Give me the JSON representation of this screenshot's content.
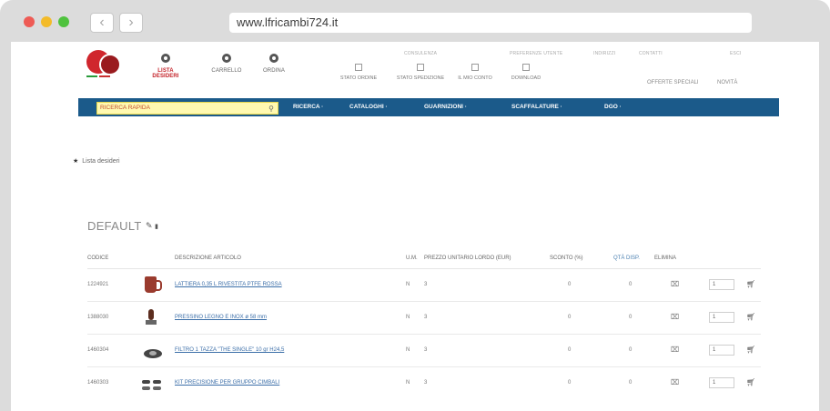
{
  "browser": {
    "url": "www.lfricambi724.it",
    "back": "‹",
    "forward": "›"
  },
  "header": {
    "user_links": [
      {
        "label": "LISTA DESIDERI",
        "icon": "heart-icon",
        "active": true
      },
      {
        "label": "CARRELLO",
        "icon": "cart-icon",
        "active": false
      },
      {
        "label": "ORDINA",
        "icon": "order-icon",
        "active": false
      }
    ],
    "top_mini_links": [
      "CONSULENZA",
      "PREFERENZE UTENTE",
      "INDIRIZZI",
      "CONTATTI",
      "ESCI"
    ],
    "status_links": [
      {
        "label": "STATO ORDINE",
        "icon": "order-status-icon"
      },
      {
        "label": "STATO SPEDIZIONE",
        "icon": "truck-icon"
      },
      {
        "label": "IL MIO CONTO",
        "icon": "account-icon"
      },
      {
        "label": "DOWNLOAD",
        "icon": "download-icon"
      }
    ],
    "right_links": [
      "OFFERTE SPECIALI",
      "NOVITÀ"
    ]
  },
  "navbar": {
    "search_placeholder": "RICERCA RAPIDA",
    "items": [
      "RICERCA ·",
      "CATALOGHI ·",
      "GUARNIZIONI ·",
      "SCAFFALATURE ·",
      "DGO ·"
    ]
  },
  "breadcrumb": {
    "label": "Lista desideri"
  },
  "group": {
    "title": "DEFAULT"
  },
  "table": {
    "headers": {
      "codice": "CODICE",
      "descrizione": "DESCRIZIONE ARTICOLO",
      "um": "U.M.",
      "prezzo": "PREZZO UNITARIO LORDO (EUR)",
      "sconto": "SCONTO (%)",
      "qta": "QTÀ DISP.",
      "elimina": "ELIMINA"
    },
    "rows": [
      {
        "code": "1224921",
        "desc": "LATTIERA 0,35 L RIVESTITA PTFE ROSSA",
        "um": "N",
        "qty": "3",
        "sconto": "0",
        "qd": "0",
        "qty_input": "1"
      },
      {
        "code": "1388030",
        "desc": "PRESSINO LEGNO E INOX ø 58 mm",
        "um": "N",
        "qty": "3",
        "sconto": "0",
        "qd": "0",
        "qty_input": "1"
      },
      {
        "code": "1460304",
        "desc": "FILTRO 1 TAZZA \"THE SINGLE\" 10 gr H24,5",
        "um": "N",
        "qty": "3",
        "sconto": "0",
        "qd": "0",
        "qty_input": "1"
      },
      {
        "code": "1460303",
        "desc": "KIT PRECISIONE PER GRUPPO CIMBALI",
        "um": "N",
        "qty": "3",
        "sconto": "0",
        "qd": "0",
        "qty_input": "1"
      }
    ]
  }
}
